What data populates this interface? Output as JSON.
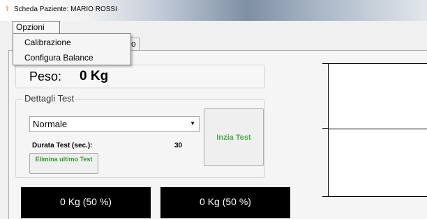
{
  "window": {
    "title": "Scheda Paziente: MARIO ROSSI"
  },
  "menubar": {
    "opzioni": "Opzioni"
  },
  "menu_opzioni": {
    "items": [
      "Calibrazione",
      "Configura Balance"
    ]
  },
  "tab": {
    "partial_label": "o"
  },
  "peso": {
    "label": "Peso:",
    "value": "0 Kg"
  },
  "dettagli": {
    "legend": "Dettagli Test",
    "select_value": "Normale",
    "durata_label": "Durata Test (sec.):",
    "durata_value": "30",
    "elimina_button": "Elimina ultimo Test",
    "inizia_button": "Inzia Test"
  },
  "panels": {
    "left": "0 Kg (50 %)",
    "right": "0 Kg (50 %)"
  },
  "colors": {
    "button_text_green": "#2e9a2e",
    "panel_bg": "#000000"
  }
}
